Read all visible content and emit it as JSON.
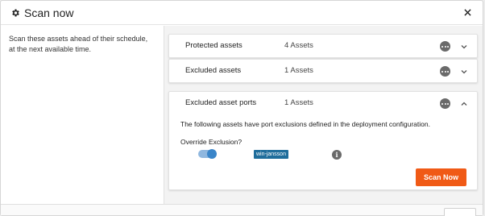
{
  "dialog": {
    "title": "Scan now",
    "title_icon": "gear-icon",
    "close_icon": "close-icon",
    "description": "Scan these assets ahead of their schedule, at the next available time."
  },
  "sections": [
    {
      "label": "Protected assets",
      "count": "4 Assets",
      "expanded": false
    },
    {
      "label": "Excluded assets",
      "count": "1 Assets",
      "expanded": false
    },
    {
      "label": "Excluded asset ports",
      "count": "1 Assets",
      "expanded": true
    }
  ],
  "ports": {
    "message": "The following assets have port exclusions defined in the deployment configuration.",
    "override_label": "Override Exclusion?",
    "override_enabled": true,
    "asset_tag": "win-jansson",
    "info_icon": "info-icon"
  },
  "actions": {
    "scan_label": "Scan Now"
  },
  "colors": {
    "accent": "#f05a16",
    "toggle": "#3a85c9",
    "tag": "#1f6d9b"
  }
}
